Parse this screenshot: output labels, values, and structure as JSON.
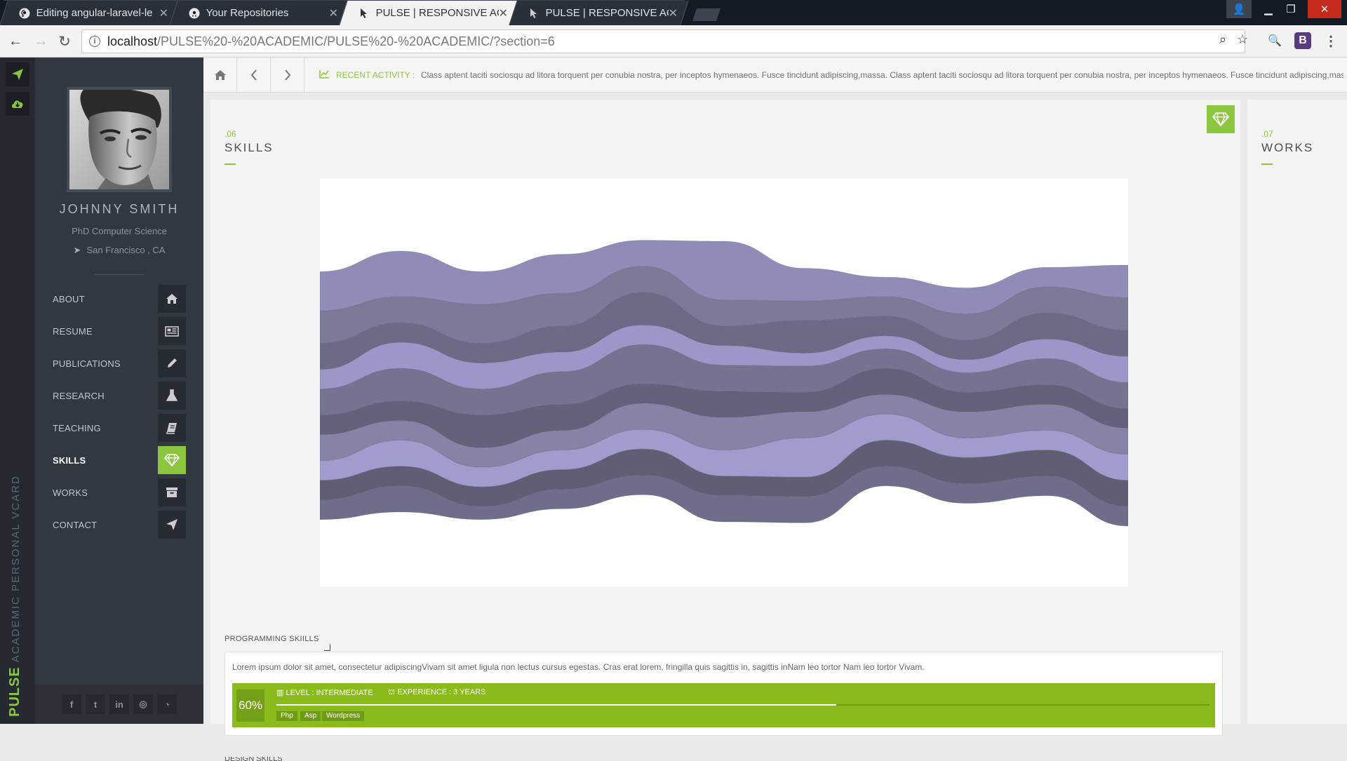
{
  "browser": {
    "tabs": [
      {
        "title": "Editing angular-laravel-le",
        "icon": "github-icon",
        "active": false
      },
      {
        "title": "Your Repositories",
        "icon": "github-icon",
        "active": false
      },
      {
        "title": "PULSE | RESPONSIVE ACA",
        "icon": "cursor-icon",
        "active": true
      },
      {
        "title": "PULSE | RESPONSIVE ACA",
        "icon": "cursor-icon",
        "active": false
      }
    ],
    "url_host": "localhost",
    "url_path": "/PULSE%20-%20ACADEMIC/PULSE%20-%20ACADEMIC/?section=6",
    "extension_letter": "B"
  },
  "brand": {
    "strong": "PULSE",
    "rest": "ACADEMIC PERSONAL VCARD"
  },
  "profile": {
    "name": "JOHNNY SMITH",
    "degree": "PhD Computer Science",
    "location": "San Francisco , CA"
  },
  "nav": [
    {
      "label": "ABOUT",
      "icon": "home-icon",
      "active": false
    },
    {
      "label": "RESUME",
      "icon": "newspaper-icon",
      "active": false
    },
    {
      "label": "PUBLICATIONS",
      "icon": "pencil-icon",
      "active": false
    },
    {
      "label": "RESEARCH",
      "icon": "flask-icon",
      "active": false
    },
    {
      "label": "TEACHING",
      "icon": "book-icon",
      "active": false
    },
    {
      "label": "SKILLS",
      "icon": "diamond-icon",
      "active": true
    },
    {
      "label": "WORKS",
      "icon": "archive-icon",
      "active": false
    },
    {
      "label": "CONTACT",
      "icon": "paper-plane-icon",
      "active": false
    }
  ],
  "social": [
    "f",
    "t",
    "in",
    "dribbble",
    "github"
  ],
  "topbar": {
    "activity_label": "RECENT ACTIVITY :",
    "activity_text": "Class aptent taciti sociosqu ad litora torquent per conubia nostra, per inceptos hymenaeos. Fusce tincidunt adipiscing,massa. Class aptent taciti sociosqu ad litora torquent per conubia nostra, per inceptos hymenaeos. Fusce tincidunt adipiscing,massa."
  },
  "skills": {
    "number": ".06",
    "title": "SKILLS",
    "programming": {
      "title": "PROGRAMMING SKIILLS",
      "description": "Lorem ipsum dolor sit amet, consectetur adipiscingVivam sit amet ligula non lectus cursus egestas. Cras erat lorem, fringilla quis sagittis in, sagittis inNam leo tortor Nam leo tortor Vivam.",
      "percent_label": "60%",
      "percent": 0.6,
      "level": "LEVEL : INTERMEDIATE",
      "experience": "EXPERIENCE : 3 YEARS",
      "tags": [
        "Php",
        "Asp",
        "Wordpress"
      ]
    },
    "next_title": "DESIGN SKILLS"
  },
  "works": {
    "number": ".07",
    "title": "WORKS"
  },
  "colors": {
    "accent": "#8cc63f",
    "sidebar": "#323840",
    "stream_light": "#9e9ccc",
    "stream_dark": "#5e5d70"
  },
  "chart_data": {
    "type": "area",
    "stacked": true,
    "offset": "streamgraph (wiggle)",
    "axes_visible": false,
    "colors": [
      "#8e8db8",
      "#7b7b98",
      "#6c6b85",
      "#9a98c8",
      "#747390",
      "#63627a",
      "#8584a6",
      "#9f9dcd",
      "#5f5e74",
      "#6e6d8a"
    ],
    "series": [
      {
        "values": [
          12,
          14,
          10,
          12,
          8,
          18,
          10,
          6,
          8,
          6,
          10
        ]
      },
      {
        "values": [
          10,
          8,
          12,
          10,
          8,
          8,
          6,
          6,
          8,
          8,
          10
        ]
      },
      {
        "values": [
          8,
          6,
          6,
          8,
          10,
          6,
          10,
          6,
          6,
          8,
          8
        ]
      },
      {
        "values": [
          6,
          8,
          8,
          6,
          6,
          6,
          4,
          4,
          4,
          6,
          8
        ]
      },
      {
        "values": [
          8,
          10,
          8,
          10,
          12,
          8,
          8,
          6,
          6,
          8,
          8
        ]
      },
      {
        "values": [
          6,
          6,
          10,
          8,
          6,
          8,
          6,
          8,
          6,
          6,
          6
        ]
      },
      {
        "values": [
          8,
          6,
          6,
          6,
          8,
          10,
          8,
          6,
          8,
          8,
          8
        ]
      },
      {
        "values": [
          6,
          8,
          6,
          6,
          6,
          8,
          12,
          8,
          6,
          6,
          8
        ]
      },
      {
        "values": [
          6,
          6,
          6,
          6,
          8,
          6,
          6,
          8,
          8,
          8,
          8
        ]
      },
      {
        "values": [
          6,
          8,
          4,
          6,
          6,
          8,
          8,
          6,
          6,
          6,
          6
        ]
      }
    ]
  }
}
